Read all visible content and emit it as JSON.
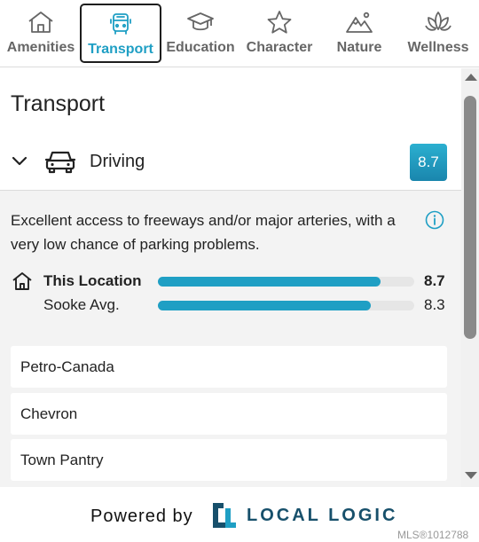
{
  "tabs": [
    {
      "label": "Amenities",
      "icon": "house-icon",
      "active": false
    },
    {
      "label": "Transport",
      "icon": "bus-icon",
      "active": true
    },
    {
      "label": "Education",
      "icon": "graduation-cap-icon",
      "active": false
    },
    {
      "label": "Character",
      "icon": "star-icon",
      "active": false
    },
    {
      "label": "Nature",
      "icon": "mountain-icon",
      "active": false
    },
    {
      "label": "Wellness",
      "icon": "lotus-icon",
      "active": false
    }
  ],
  "panel": {
    "title": "Transport",
    "category": {
      "label": "Driving",
      "icon": "car-icon",
      "score": "8.7",
      "expanded": true
    },
    "description": "Excellent access to freeways and/or major arteries, with a very low chance of parking problems.",
    "comparison": [
      {
        "label": "This Location",
        "value": "8.7",
        "level": 0.87,
        "icon": "home-icon"
      },
      {
        "label": "Sooke Avg.",
        "value": "8.3",
        "level": 0.83
      }
    ],
    "places": [
      "Petro-Canada",
      "Chevron",
      "Town Pantry"
    ]
  },
  "footer": {
    "powered_by": "Powered by",
    "brand": "LOCAL LOGIC",
    "mls": "MLS®1012788"
  },
  "colors": {
    "accent": "#1f9fc4",
    "brand": "#17506b",
    "badge": "#2196be"
  }
}
